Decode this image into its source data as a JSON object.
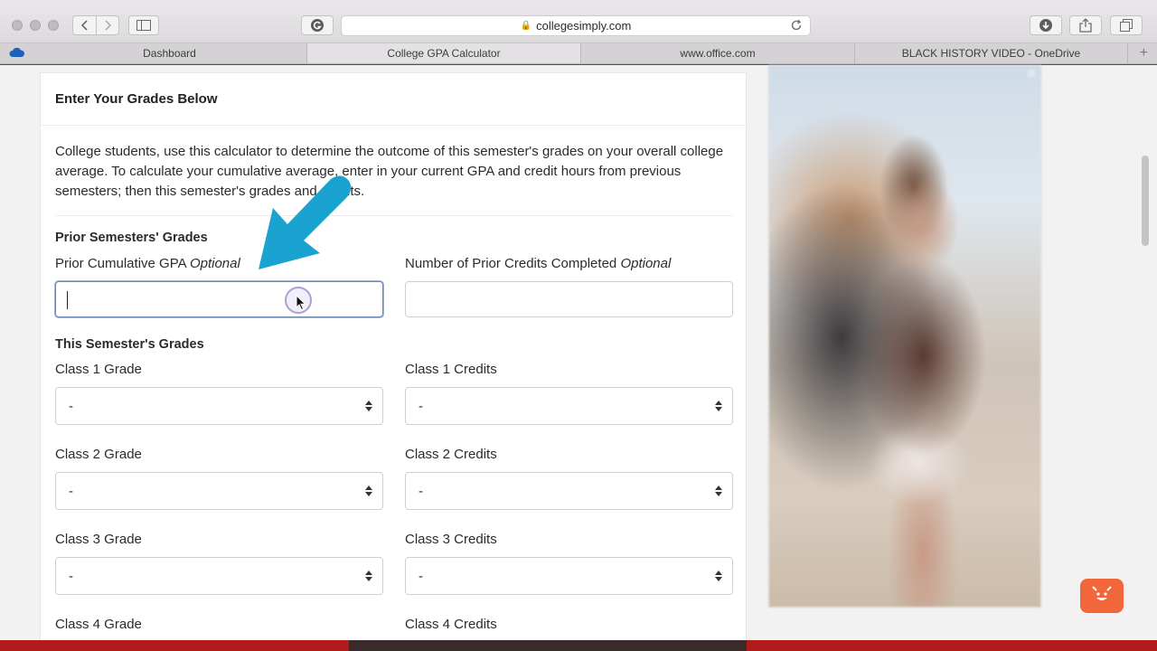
{
  "browser": {
    "url": "collegesimply.com",
    "tabs": [
      {
        "label": "Dashboard",
        "active": false
      },
      {
        "label": "College GPA Calculator",
        "active": true
      },
      {
        "label": "www.office.com",
        "active": false
      },
      {
        "label": "BLACK HISTORY VIDEO - OneDrive",
        "active": false
      }
    ],
    "new_tab_label": "+"
  },
  "calculator": {
    "header": "Enter Your Grades Below",
    "intro": "College students, use this calculator to determine the outcome of this semester's grades on your overall college average. To calculate your cumulative average, enter in your current GPA and credit hours from previous semesters; then this semester's grades and credits.",
    "prior_section": "Prior Semesters' Grades",
    "prior_gpa": {
      "label": "Prior Cumulative GPA",
      "optional": "Optional",
      "value": ""
    },
    "prior_credits": {
      "label": "Number of Prior Credits Completed",
      "optional": "Optional",
      "value": ""
    },
    "this_section": "This Semester's Grades",
    "classes": [
      {
        "grade_label": "Class 1 Grade",
        "grade_value": "-",
        "credits_label": "Class 1 Credits",
        "credits_value": "-"
      },
      {
        "grade_label": "Class 2 Grade",
        "grade_value": "-",
        "credits_label": "Class 2 Credits",
        "credits_value": "-"
      },
      {
        "grade_label": "Class 3 Grade",
        "grade_value": "-",
        "credits_label": "Class 3 Credits",
        "credits_value": "-"
      },
      {
        "grade_label": "Class 4 Grade",
        "grade_value": "-",
        "credits_label": "Class 4 Credits",
        "credits_value": "-"
      }
    ]
  },
  "colors": {
    "arrow": "#1aa3d1",
    "chat_button": "#f2663c",
    "focus_border": "#6b88b5"
  },
  "icons": [
    "back-icon",
    "forward-icon",
    "sidebar-icon",
    "grammarly-icon",
    "lock-icon",
    "reload-icon",
    "download-icon",
    "share-icon",
    "tabs-icon",
    "onedrive-cloud-icon",
    "arrow-annotation-icon",
    "cursor-icon",
    "chat-face-icon"
  ]
}
